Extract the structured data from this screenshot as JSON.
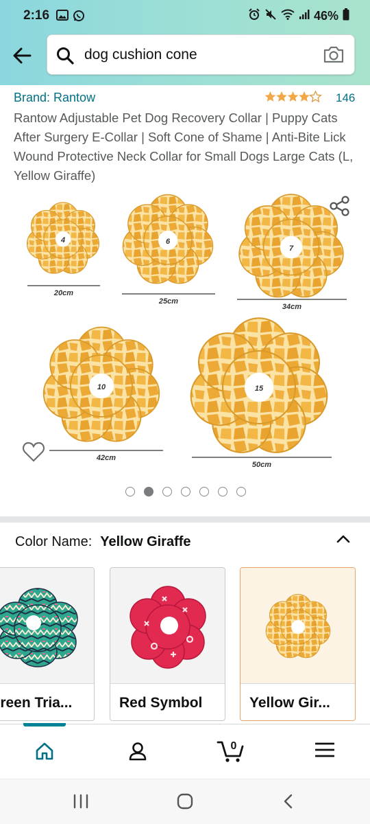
{
  "status": {
    "time": "2:16",
    "battery": "46%"
  },
  "search": {
    "query": "dog cushion cone"
  },
  "product": {
    "brand": "Brand: Rantow",
    "rating_count": "146",
    "rating": 4.5,
    "title": "Rantow Adjustable Pet Dog Recovery Collar | Puppy Cats After Surgery E-Collar | Soft Cone of Shame | Anti-Bite Lick Wound Protective Neck Collar for Small Dogs Large Cats (L, Yellow Giraffe)"
  },
  "image": {
    "collars": [
      {
        "inner": "4",
        "width": "20cm"
      },
      {
        "inner": "6",
        "width": "25cm"
      },
      {
        "inner": "7",
        "width": "34cm"
      },
      {
        "inner": "10",
        "width": "42cm"
      },
      {
        "inner": "15",
        "width": "50cm"
      }
    ],
    "total_images": 7,
    "active_image": 2
  },
  "color": {
    "label": "Color Name:",
    "value": "Yellow Giraffe",
    "swatches": [
      {
        "label": "Green Tria...",
        "selected": false
      },
      {
        "label": "Red Symbol",
        "selected": false
      },
      {
        "label": "Yellow Gir...",
        "selected": true
      }
    ]
  },
  "colors": {
    "link": "#007185",
    "star": "#f3a847",
    "accent": "#008296",
    "giraffe": "#f0b93c"
  },
  "bottom_nav": {
    "cart_count": "0"
  }
}
